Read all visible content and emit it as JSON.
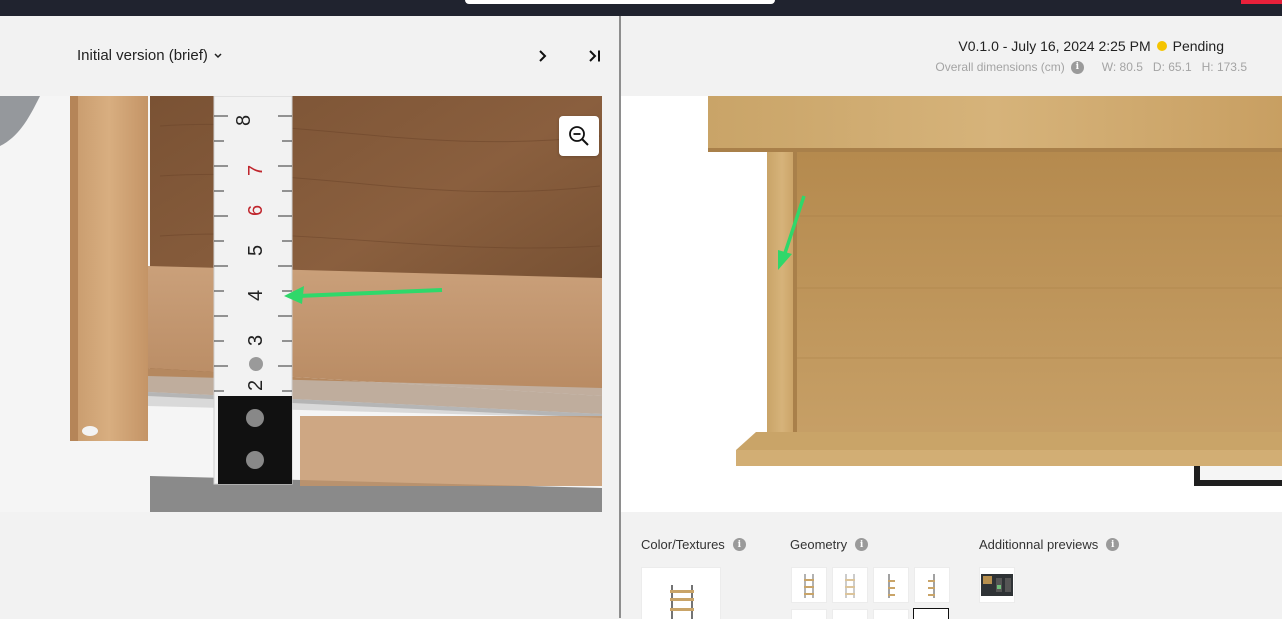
{
  "left_header": {
    "version_label": "Initial version (brief)",
    "next_icon": "chevron-right-icon",
    "last_icon": "skip-to-end-icon"
  },
  "right_header": {
    "version_line": "V0.1.0 - July 16, 2024 2:25 PM",
    "status": "Pending",
    "status_color": "#f5c400",
    "dims_label": "Overall dimensions (cm)",
    "width": "W: 80.5",
    "depth": "D: 65.1",
    "height": "H: 173.5"
  },
  "bottom_panel": {
    "color_textures": "Color/Textures",
    "geometry": "Geometry",
    "additional_previews": "Additionnal previews"
  },
  "photo": {
    "tape_numbers": [
      "8",
      "7",
      "6",
      "5",
      "4",
      "3",
      "2"
    ]
  },
  "colors": {
    "topbar": "#20232f",
    "accent_red": "#e8203a",
    "arrow_green": "#2fd86a"
  }
}
